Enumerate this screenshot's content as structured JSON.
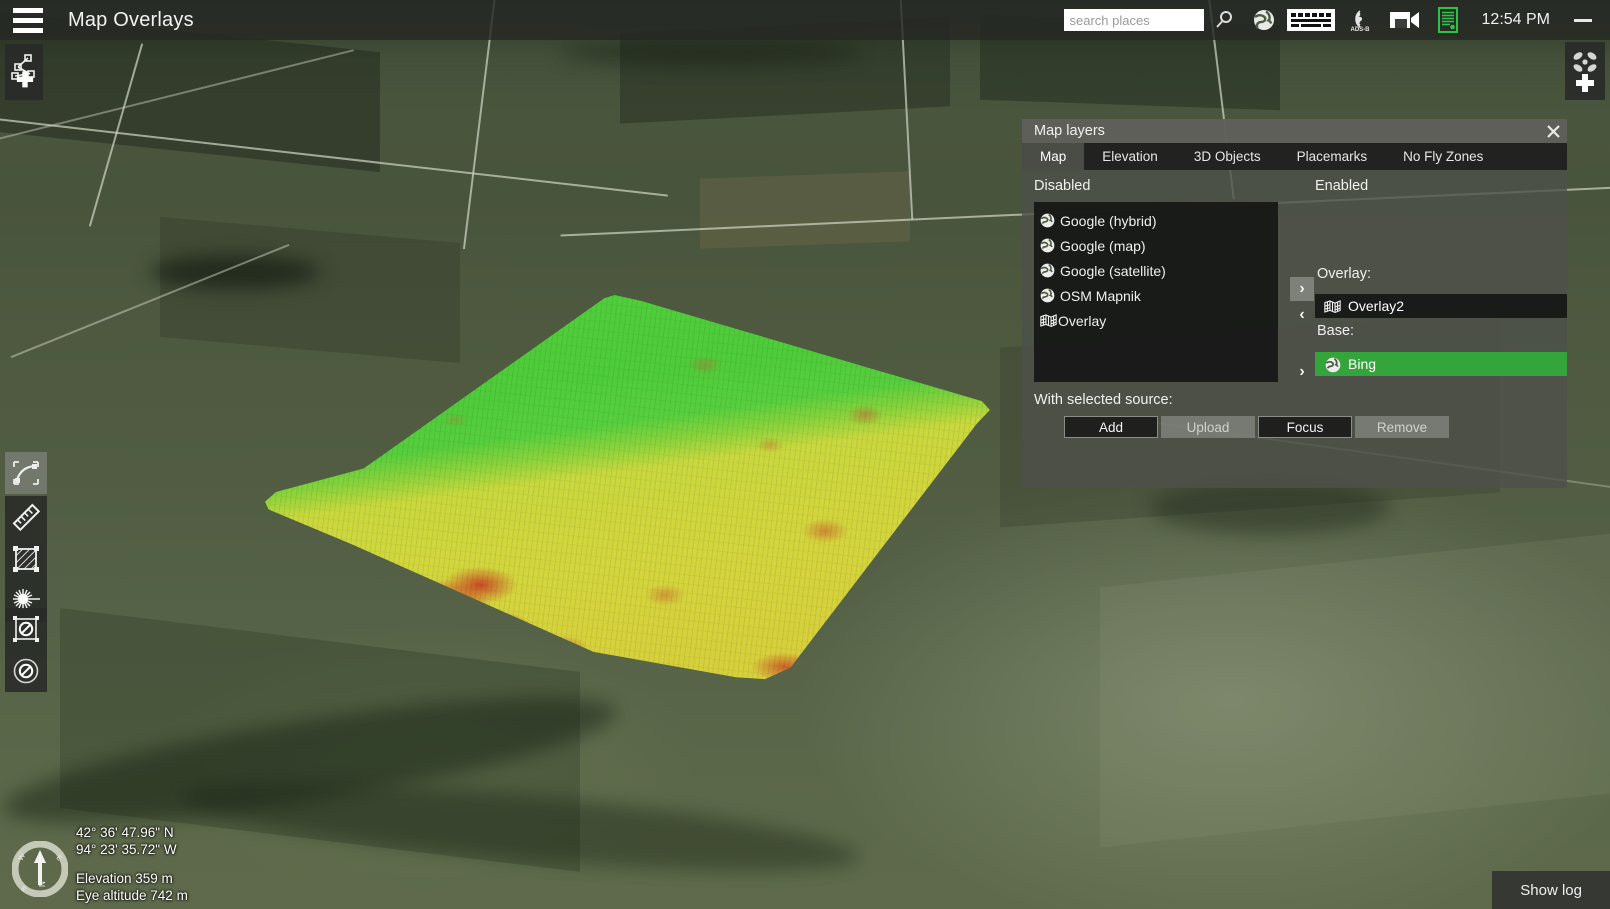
{
  "window": {
    "title": "Map Overlays"
  },
  "topbar": {
    "menu_icon": "hamburger-icon",
    "search": {
      "value": "",
      "placeholder": "search places"
    },
    "icons": [
      {
        "name": "search-magnifier-icon",
        "label": "Search"
      },
      {
        "name": "globe-icon",
        "label": "Globe"
      },
      {
        "name": "keyboard-icon",
        "label": "Keyboard"
      },
      {
        "name": "adsb-icon",
        "label": "ADS-B"
      },
      {
        "name": "video-camera-icon",
        "label": "Video"
      },
      {
        "name": "log-document-icon",
        "label": "Log"
      }
    ],
    "adsb_label": "ADS-B",
    "clock": "12:54 PM",
    "minimize_label": "—"
  },
  "tools": {
    "top_left": {
      "name": "add-waypoint-icon",
      "label": "Add waypoint"
    },
    "top_right": {
      "name": "add-vehicle-icon",
      "label": "Add vehicle"
    },
    "left_stack": [
      {
        "name": "edit-path-tool",
        "label": "Edit path",
        "selected": true
      },
      {
        "name": "ruler-measure-tool",
        "label": "Measure",
        "selected": false
      },
      {
        "name": "area-survey-tool",
        "label": "Survey area",
        "selected": false
      },
      {
        "name": "structure-scan-tool",
        "label": "Structure scan",
        "selected": false
      },
      {
        "name": "no-fly-zone-area-tool",
        "label": "No fly zone area",
        "selected": false
      },
      {
        "name": "no-fly-zone-circle-tool",
        "label": "No fly zone circle",
        "selected": false
      }
    ]
  },
  "status": {
    "latitude": "42° 36' 47.96\" N",
    "longitude": "94° 23' 35.72\" W",
    "elevation": "Elevation 359 m",
    "eye_altitude": "Eye altitude 742 m",
    "compass_north": "N",
    "show_log_label": "Show log"
  },
  "map_layers_panel": {
    "title": "Map layers",
    "close_label": "✕",
    "tabs": [
      {
        "label": "Map",
        "active": true
      },
      {
        "label": "Elevation",
        "active": false
      },
      {
        "label": "3D Objects",
        "active": false
      },
      {
        "label": "Placemarks",
        "active": false
      },
      {
        "label": "No Fly Zones",
        "active": false
      }
    ],
    "disabled_label": "Disabled",
    "enabled_label": "Enabled",
    "disabled_sources": [
      {
        "label": "Google (hybrid)",
        "icon": "globe-icon"
      },
      {
        "label": "Google (map)",
        "icon": "globe-icon"
      },
      {
        "label": "Google (satellite)",
        "icon": "globe-icon"
      },
      {
        "label": "OSM Mapnik",
        "icon": "globe-icon"
      },
      {
        "label": "Overlay",
        "icon": "map-overlay-icon"
      }
    ],
    "move_right_label": "›",
    "move_left_label": "‹",
    "move_right_base_label": "›",
    "overlay_group_label": "Overlay:",
    "overlay_items": [
      {
        "label": "Overlay2",
        "icon": "map-overlay-icon",
        "selected": false
      }
    ],
    "base_group_label": "Base:",
    "base_items": [
      {
        "label": "Bing",
        "icon": "globe-icon",
        "selected": true
      }
    ],
    "with_selected_label": "With selected source:",
    "buttons": [
      {
        "label": "Add",
        "enabled": true
      },
      {
        "label": "Upload",
        "enabled": false
      },
      {
        "label": "Focus",
        "enabled": true
      },
      {
        "label": "Remove",
        "enabled": false
      }
    ],
    "selected_color": "#34a53a"
  },
  "map_view": {
    "overlay_name": "Overlay2",
    "overlay_description": "Crop health NDVI overlay (green to yellow to red)",
    "colors": {
      "high": "#4fd63a",
      "mid": "#dfdd3c",
      "low": "#d6302a"
    }
  }
}
